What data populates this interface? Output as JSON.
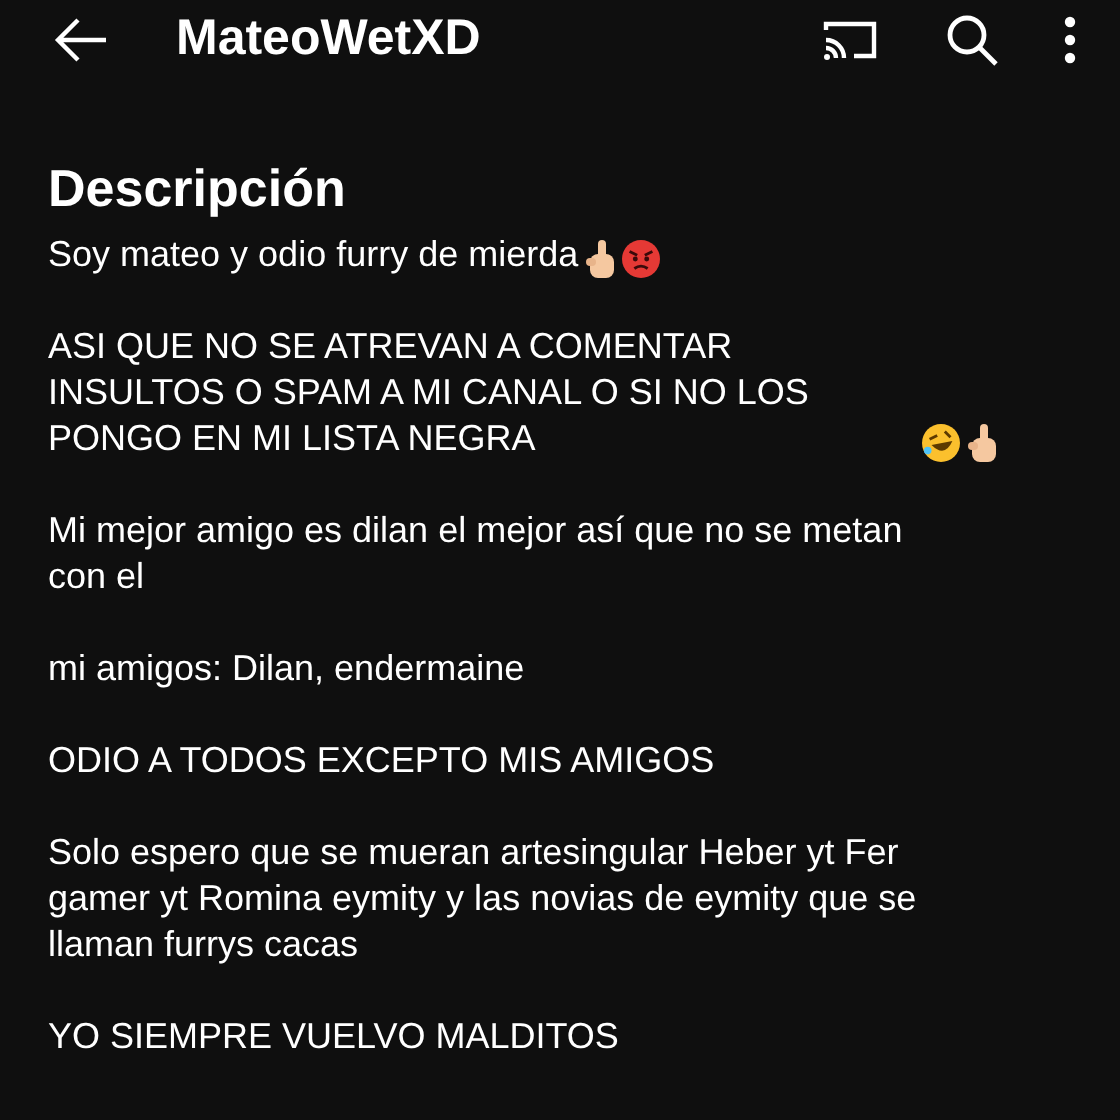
{
  "top_bar": {
    "title": "MateoWetXD"
  },
  "description": {
    "heading": "Descripción",
    "paragraphs": [
      {
        "text": "Soy mateo y odio furry de mierda",
        "kind": "angry"
      },
      {
        "text": "ASI QUE NO SE ATREVAN A COMENTAR INSULTOS O SPAM A MI CANAL O SI NO LOS PONGO EN MI LISTA NEGRA",
        "kind": "laugh"
      },
      {
        "text": "Mi mejor amigo es dilan el mejor así que no se metan con el",
        "kind": "plain"
      },
      {
        "text": "mi amigos: Dilan, endermaine",
        "kind": "plain"
      },
      {
        "text": "ODIO A TODOS EXCEPTO MIS AMIGOS",
        "kind": "plain"
      },
      {
        "text": "Solo espero que se mueran artesingular Heber yt Fer gamer yt Romina eymity y las novias de eymity que se llaman furrys cacas",
        "kind": "plain"
      },
      {
        "text": "YO SIEMPRE VUELVO MALDITOS",
        "kind": "plain"
      }
    ]
  }
}
